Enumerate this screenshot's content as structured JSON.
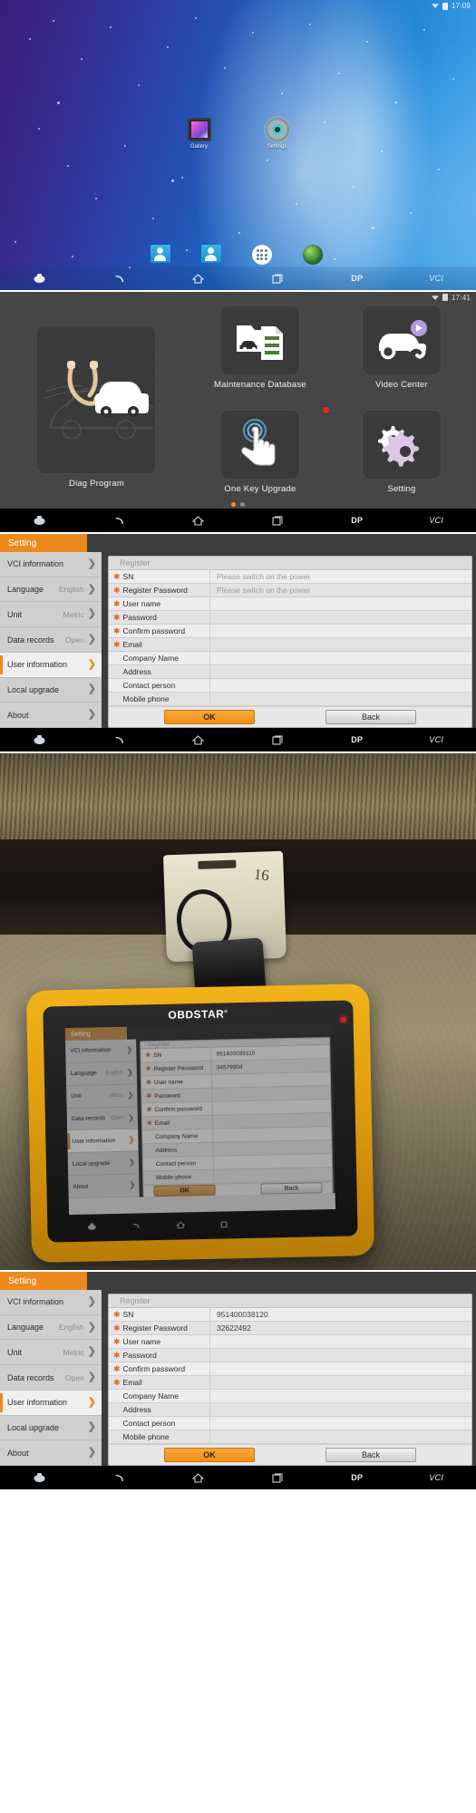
{
  "panels": {
    "home": {
      "statusbar": {
        "time": "17:09",
        "wifi_icon": "wifi-icon",
        "battery_icon": "battery-icon"
      },
      "apps": [
        {
          "label": "Gallery",
          "icon": "gallery-icon"
        },
        {
          "label": "Settings",
          "icon": "gear-icon"
        }
      ],
      "dock": [
        {
          "icon": "phone-contact-icon"
        },
        {
          "icon": "contacts-icon"
        },
        {
          "icon": "all-apps-icon"
        },
        {
          "icon": "browser-globe-icon"
        }
      ],
      "navbar": [
        {
          "icon": "screenshot-icon",
          "label": ""
        },
        {
          "icon": "back-icon",
          "label": ""
        },
        {
          "icon": "home-icon",
          "label": ""
        },
        {
          "icon": "recents-icon",
          "label": ""
        },
        {
          "icon": "",
          "label": "DP"
        },
        {
          "icon": "",
          "label": "VCI"
        }
      ]
    },
    "menu": {
      "statusbar": {
        "time": "17:41",
        "wifi_icon": "wifi-icon",
        "battery_icon": "battery-icon"
      },
      "tiles": [
        {
          "label": "Diag Program",
          "icon": "stethoscope-car-icon",
          "badge": false
        },
        {
          "label": "Maintenance Database",
          "icon": "folder-document-car-icon",
          "badge": false
        },
        {
          "label": "Video Center",
          "icon": "car-play-icon",
          "badge": false
        },
        {
          "label": "One Key Upgrade",
          "icon": "tap-hand-icon",
          "badge": true
        },
        {
          "label": "Setting",
          "icon": "gears-icon",
          "badge": false
        }
      ],
      "pager": {
        "pages": 2,
        "active": 0
      },
      "navbar": [
        {
          "icon": "screenshot-icon",
          "label": ""
        },
        {
          "icon": "back-icon",
          "label": ""
        },
        {
          "icon": "home-icon",
          "label": ""
        },
        {
          "icon": "recents-icon",
          "label": ""
        },
        {
          "icon": "",
          "label": "DP"
        },
        {
          "icon": "",
          "label": "VCI"
        }
      ]
    },
    "setting_empty": {
      "tab_label": "Setting",
      "sidebar": [
        {
          "label": "VCI information",
          "value": "",
          "active": false
        },
        {
          "label": "Language",
          "value": "English",
          "active": false
        },
        {
          "label": "Unit",
          "value": "Metric",
          "active": false
        },
        {
          "label": "Data records",
          "value": "Open",
          "active": false
        },
        {
          "label": "User information",
          "value": "",
          "active": true
        },
        {
          "label": "Local upgrade",
          "value": "",
          "active": false
        },
        {
          "label": "About",
          "value": "",
          "active": false
        }
      ],
      "form": {
        "title": "Register",
        "rows": [
          {
            "label": "SN",
            "required": true,
            "value": "",
            "placeholder": "Please switch on the power"
          },
          {
            "label": "Register Password",
            "required": true,
            "value": "",
            "placeholder": "Please switch on the power"
          },
          {
            "label": "User name",
            "required": true,
            "value": "",
            "placeholder": ""
          },
          {
            "label": "Password",
            "required": true,
            "value": "",
            "placeholder": ""
          },
          {
            "label": "Confirm password",
            "required": true,
            "value": "",
            "placeholder": ""
          },
          {
            "label": "Email",
            "required": true,
            "value": "",
            "placeholder": ""
          },
          {
            "label": "Company Name",
            "required": false,
            "value": "",
            "placeholder": ""
          },
          {
            "label": "Address",
            "required": false,
            "value": "",
            "placeholder": ""
          },
          {
            "label": "Contact person",
            "required": false,
            "value": "",
            "placeholder": ""
          },
          {
            "label": "Mobile phone",
            "required": false,
            "value": "",
            "placeholder": ""
          }
        ],
        "ok_label": "OK",
        "back_label": "Back"
      },
      "navbar": [
        {
          "icon": "screenshot-icon",
          "label": ""
        },
        {
          "icon": "back-icon",
          "label": ""
        },
        {
          "icon": "home-icon",
          "label": ""
        },
        {
          "icon": "recents-icon",
          "label": ""
        },
        {
          "icon": "",
          "label": "DP"
        },
        {
          "icon": "",
          "label": "VCI"
        }
      ]
    },
    "photo": {
      "brand": "OBDSTAR",
      "brand_mark": "®",
      "bracket_marking": "16",
      "device_screen": {
        "tab_label": "Setting",
        "sidebar": [
          {
            "label": "VCI information",
            "value": "",
            "active": false
          },
          {
            "label": "Language",
            "value": "English",
            "active": false
          },
          {
            "label": "Unit",
            "value": "Metric",
            "active": false
          },
          {
            "label": "Data records",
            "value": "Open",
            "active": false
          },
          {
            "label": "User information",
            "value": "",
            "active": true
          },
          {
            "label": "Local upgrade",
            "value": "",
            "active": false
          },
          {
            "label": "About",
            "value": "",
            "active": false
          }
        ],
        "form": {
          "title": "Register",
          "rows": [
            {
              "label": "SN",
              "required": true,
              "value": "951400039110",
              "placeholder": ""
            },
            {
              "label": "Register Password",
              "required": true,
              "value": "34579904",
              "placeholder": ""
            },
            {
              "label": "User name",
              "required": true,
              "value": "",
              "placeholder": ""
            },
            {
              "label": "Password",
              "required": true,
              "value": "",
              "placeholder": ""
            },
            {
              "label": "Confirm password",
              "required": true,
              "value": "",
              "placeholder": ""
            },
            {
              "label": "Email",
              "required": true,
              "value": "",
              "placeholder": ""
            },
            {
              "label": "Company Name",
              "required": false,
              "value": "",
              "placeholder": ""
            },
            {
              "label": "Address",
              "required": false,
              "value": "",
              "placeholder": ""
            },
            {
              "label": "Contact person",
              "required": false,
              "value": "",
              "placeholder": ""
            },
            {
              "label": "Mobile phone",
              "required": false,
              "value": "",
              "placeholder": ""
            }
          ],
          "ok_label": "OK",
          "back_label": "Back"
        }
      }
    },
    "setting_filled": {
      "tab_label": "Setting",
      "sidebar": [
        {
          "label": "VCI information",
          "value": "",
          "active": false
        },
        {
          "label": "Language",
          "value": "English",
          "active": false
        },
        {
          "label": "Unit",
          "value": "Metric",
          "active": false
        },
        {
          "label": "Data records",
          "value": "Open",
          "active": false
        },
        {
          "label": "User information",
          "value": "",
          "active": true
        },
        {
          "label": "Local upgrade",
          "value": "",
          "active": false
        },
        {
          "label": "About",
          "value": "",
          "active": false
        }
      ],
      "form": {
        "title": "Register",
        "rows": [
          {
            "label": "SN",
            "required": true,
            "value": "951400038120",
            "placeholder": ""
          },
          {
            "label": "Register Password",
            "required": true,
            "value": "32622492",
            "placeholder": ""
          },
          {
            "label": "User name",
            "required": true,
            "value": "",
            "placeholder": ""
          },
          {
            "label": "Password",
            "required": true,
            "value": "",
            "placeholder": ""
          },
          {
            "label": "Confirm password",
            "required": true,
            "value": "",
            "placeholder": ""
          },
          {
            "label": "Email",
            "required": true,
            "value": "",
            "placeholder": ""
          },
          {
            "label": "Company Name",
            "required": false,
            "value": "",
            "placeholder": ""
          },
          {
            "label": "Address",
            "required": false,
            "value": "",
            "placeholder": ""
          },
          {
            "label": "Contact person",
            "required": false,
            "value": "",
            "placeholder": ""
          },
          {
            "label": "Mobile phone",
            "required": false,
            "value": "",
            "placeholder": ""
          }
        ],
        "ok_label": "OK",
        "back_label": "Back"
      },
      "navbar": [
        {
          "icon": "screenshot-icon",
          "label": ""
        },
        {
          "icon": "back-icon",
          "label": ""
        },
        {
          "icon": "home-icon",
          "label": ""
        },
        {
          "icon": "recents-icon",
          "label": ""
        },
        {
          "icon": "",
          "label": "DP"
        },
        {
          "icon": "",
          "label": "VCI"
        }
      ]
    }
  },
  "colors": {
    "accent_orange": "#ec8a1e",
    "badge_red": "#ee2020",
    "required_star": "#e8661b",
    "dark_chrome": "#3c3c3c"
  }
}
